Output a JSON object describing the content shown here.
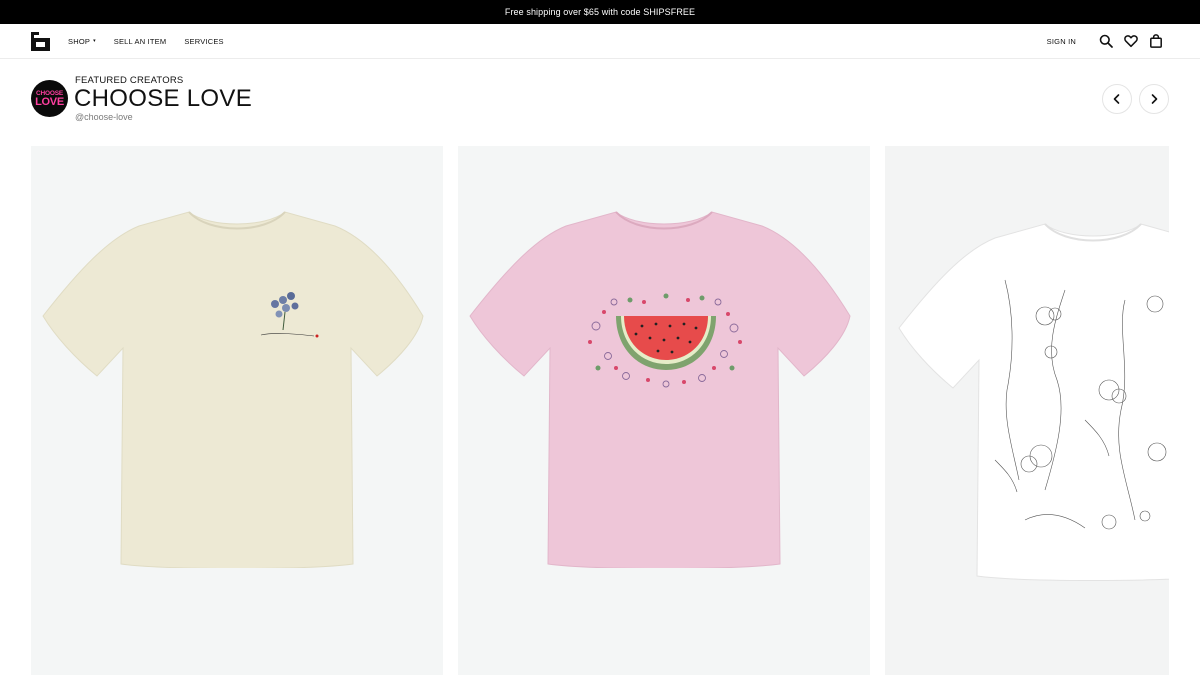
{
  "promo": {
    "text": "Free shipping over $65 with code SHIPSFREE"
  },
  "nav": {
    "logo_icon": "depop-style-logo-icon",
    "links": [
      {
        "label": "SHOP",
        "has_caret": true
      },
      {
        "label": "SELL AN ITEM"
      },
      {
        "label": "SERVICES"
      }
    ],
    "caret": "▾",
    "sign_in": "SIGN IN",
    "icons": [
      "search-icon",
      "heart-icon",
      "bag-icon"
    ]
  },
  "creator": {
    "section_label": "FEATURED CREATORS",
    "name": "CHOOSE LOVE",
    "handle": "@choose-love",
    "avatar_text_top": "CHOOSE",
    "avatar_text_bottom": "LOVE",
    "avatar_accent": "#ff3fa0"
  },
  "carousel": {
    "prev_icon": "chevron-left-icon",
    "next_icon": "chevron-right-icon",
    "products": [
      {
        "shirt_color": "#ede9d4",
        "graphic": "blue-flowers-small-print"
      },
      {
        "shirt_color": "#eec6d8",
        "graphic": "watermelon-slice-print"
      },
      {
        "shirt_color": "#f4f4f4",
        "graphic": "line-drawing-figures-print"
      }
    ]
  }
}
